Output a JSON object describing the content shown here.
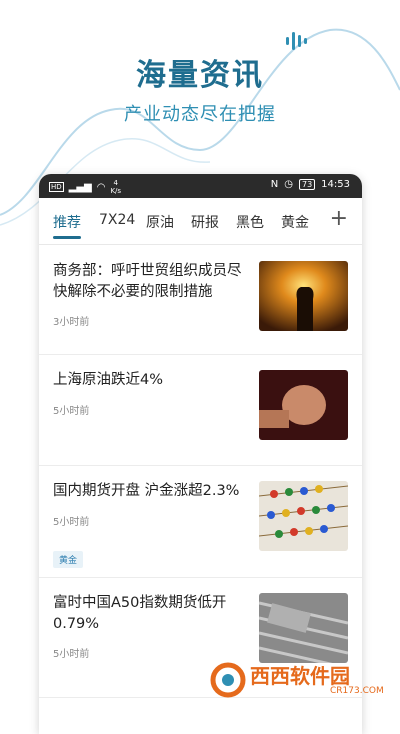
{
  "hero": {
    "title": "海量资讯",
    "subtitle": "产业动态尽在把握"
  },
  "status_bar": {
    "speed_value": "4",
    "speed_unit": "K/s",
    "battery": "73",
    "time": "14:53"
  },
  "tabs": [
    {
      "label": "推荐",
      "active": true
    },
    {
      "label": "7X24",
      "active": false
    },
    {
      "label": "原油",
      "active": false
    },
    {
      "label": "研报",
      "active": false
    },
    {
      "label": "黑色",
      "active": false
    },
    {
      "label": "黄金",
      "active": false
    }
  ],
  "add_tab": "+",
  "news": [
    {
      "title": "商务部：呼吁世贸组织成员尽快解除不必要的限制措施",
      "time": "3小时前"
    },
    {
      "title": "上海原油跌近4%",
      "time": "5小时前"
    },
    {
      "title": "国内期货开盘 沪金涨超2.3%",
      "time": "5小时前",
      "tag": "黄金"
    },
    {
      "title": "富时中国A50指数期货低开0.79%",
      "time": "5小时前"
    }
  ],
  "watermark": {
    "brand": "西西软件园",
    "url": "CR173.COM"
  },
  "colors": {
    "accent": "#1f6d8f",
    "status_bar": "#2b2b2b"
  }
}
